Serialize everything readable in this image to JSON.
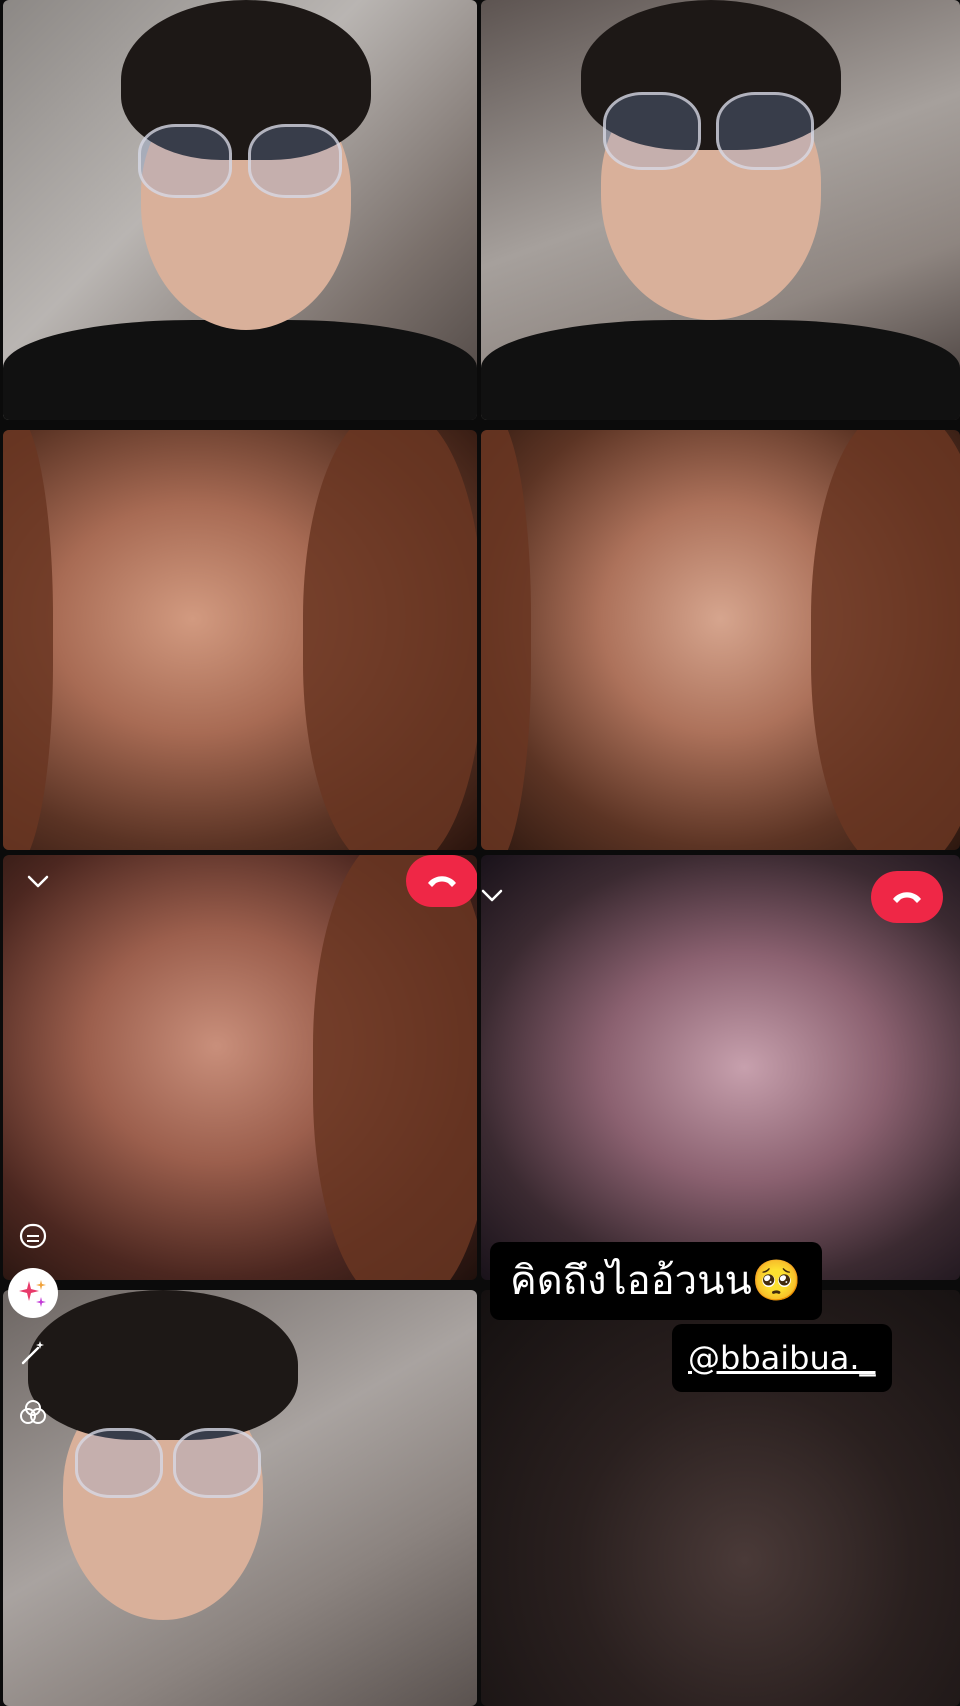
{
  "story": {
    "caption_text": "คิดถึงไออ้วนน🥺",
    "mention": "@bbaibua._"
  },
  "call_ui": {
    "collapse_icon": "chevron-down-icon",
    "end_call_icon": "phone-hangup-icon",
    "end_call_color": "#ef2746"
  },
  "side_tools": [
    {
      "name": "caption-bubble-icon"
    },
    {
      "name": "sparkles-icon"
    },
    {
      "name": "magic-wand-icon"
    },
    {
      "name": "overlap-circles-icon"
    }
  ]
}
